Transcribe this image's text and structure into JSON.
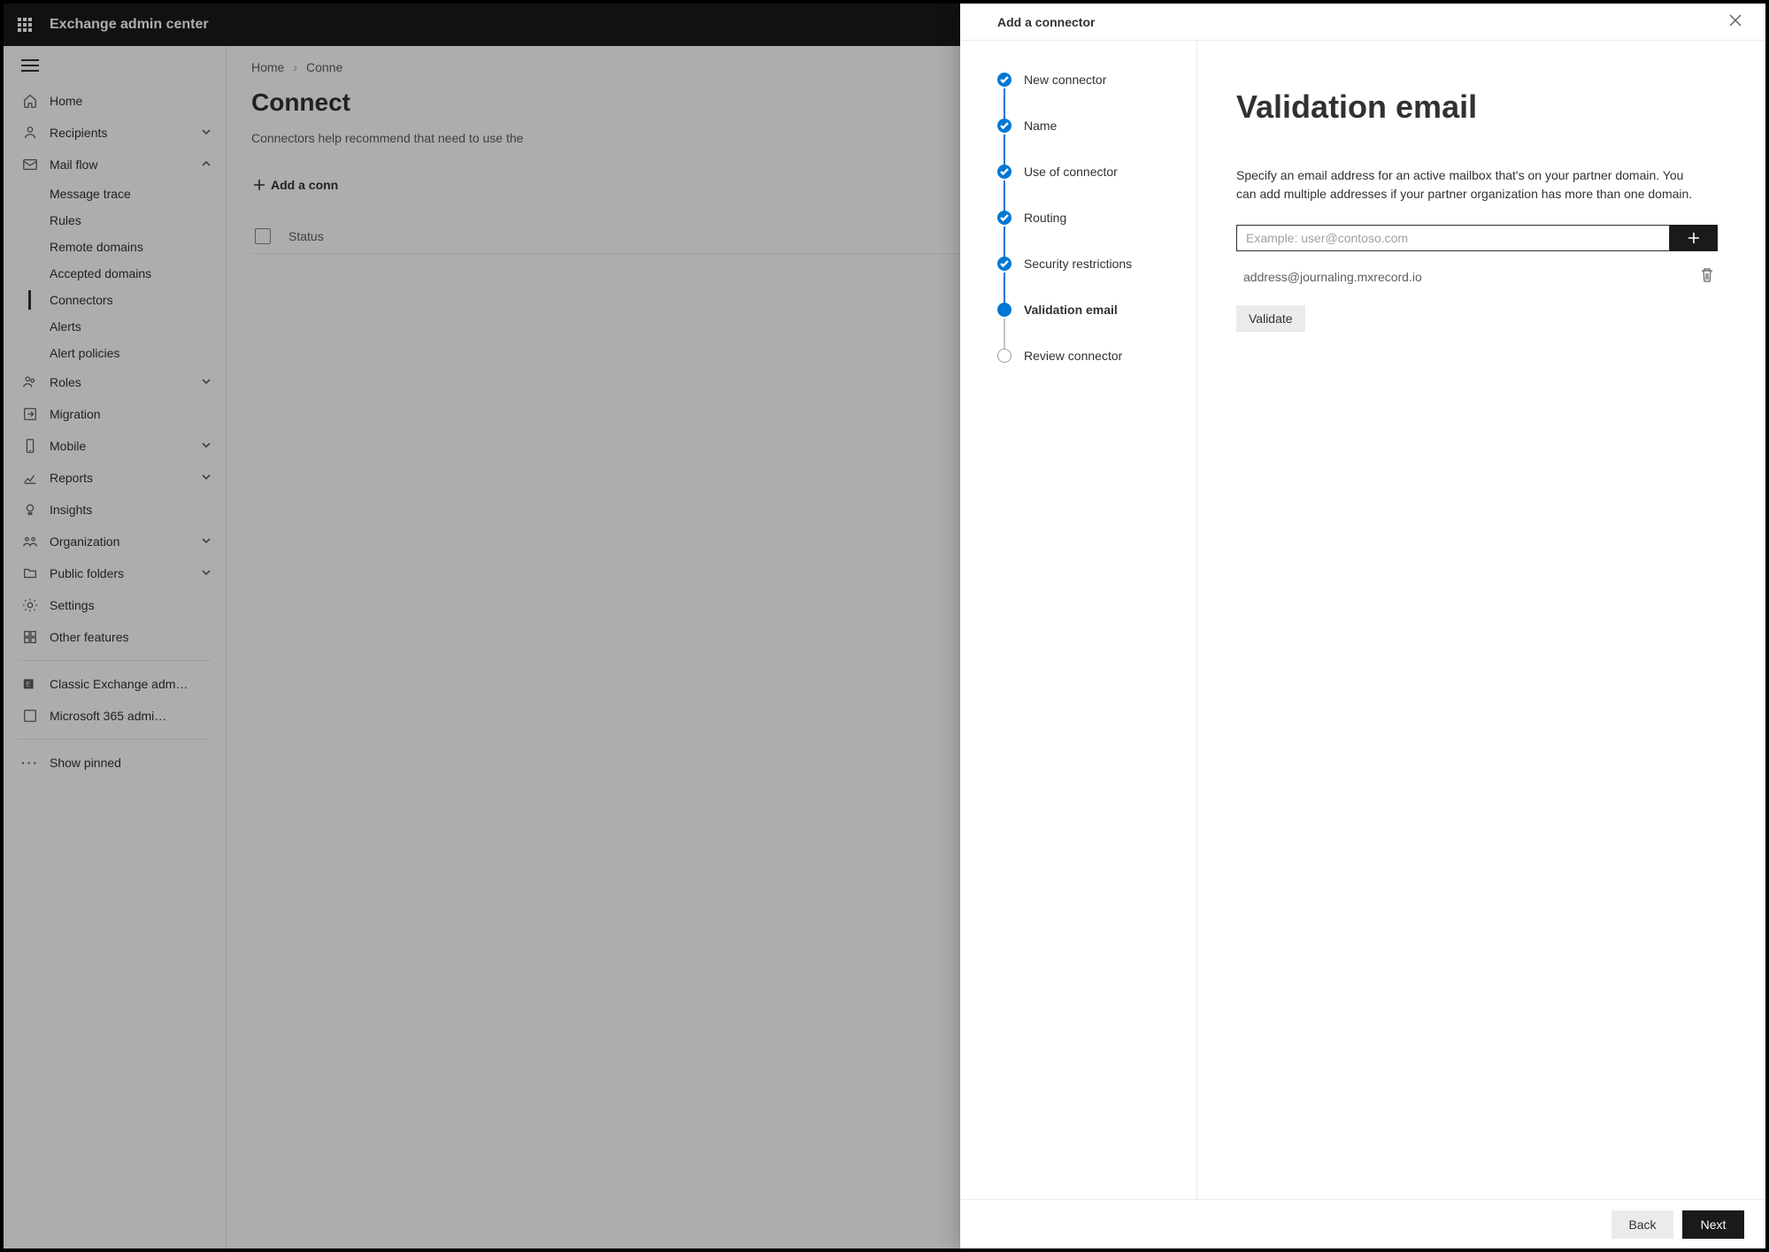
{
  "topbar": {
    "title": "Exchange admin center"
  },
  "sidebar": {
    "home": "Home",
    "recipients": "Recipients",
    "mailflow": "Mail flow",
    "mailflow_children": {
      "message_trace": "Message trace",
      "rules": "Rules",
      "remote_domains": "Remote domains",
      "accepted_domains": "Accepted domains",
      "connectors": "Connectors",
      "alerts": "Alerts",
      "alert_policies": "Alert policies"
    },
    "roles": "Roles",
    "migration": "Migration",
    "mobile": "Mobile",
    "reports": "Reports",
    "insights": "Insights",
    "organization": "Organization",
    "public_folders": "Public folders",
    "settings": "Settings",
    "other_features": "Other features",
    "classic": "Classic Exchange adm…",
    "m365": "Microsoft 365 admi…",
    "show_pinned": "Show pinned"
  },
  "main": {
    "breadcrumb_home": "Home",
    "breadcrumb_current": "Conne",
    "page_title": "Connect",
    "page_desc": "Connectors help recommend that need to use the",
    "add_btn": "Add a conn",
    "th_status": "Status"
  },
  "modal": {
    "title": "Add a connector",
    "steps": {
      "new_connector": "New connector",
      "name": "Name",
      "use": "Use of connector",
      "routing": "Routing",
      "security": "Security restrictions",
      "validation": "Validation email",
      "review": "Review connector"
    },
    "content": {
      "heading": "Validation email",
      "description": "Specify an email address for an active mailbox that's on your partner domain. You can add multiple addresses if your partner organization has more than one domain.",
      "placeholder": "Example: user@contoso.com",
      "chip": "address@journaling.mxrecord.io",
      "validate_btn": "Validate"
    },
    "footer": {
      "back": "Back",
      "next": "Next"
    }
  }
}
